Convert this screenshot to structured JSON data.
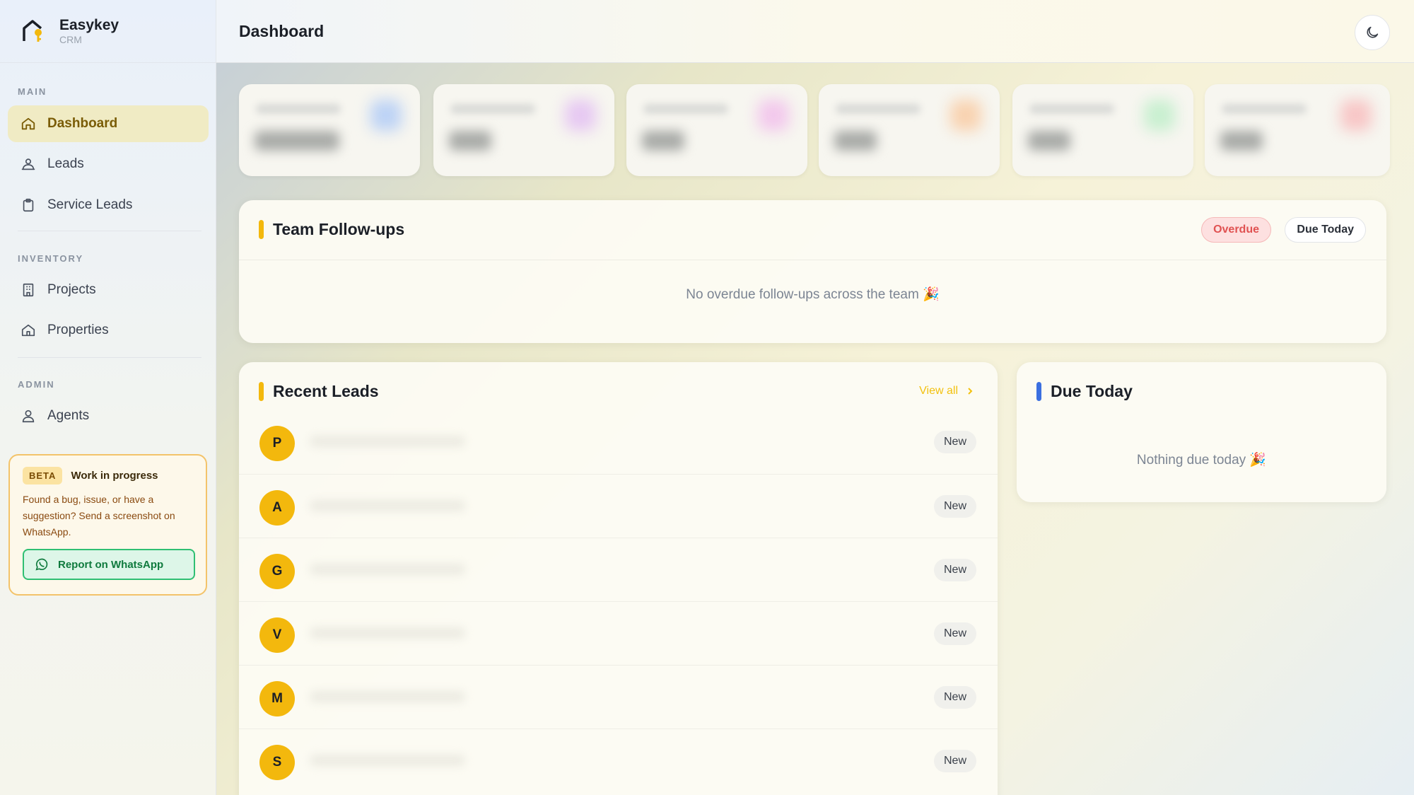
{
  "brand": {
    "name": "Easykey",
    "sub": "CRM"
  },
  "header": {
    "title": "Dashboard",
    "theme_icon": "moon-icon"
  },
  "sidebar": {
    "sections": [
      {
        "title": "MAIN"
      },
      {
        "title": "INVENTORY"
      },
      {
        "title": "ADMIN"
      }
    ],
    "items": [
      {
        "label": "Dashboard",
        "icon": "home-icon",
        "active": true
      },
      {
        "label": "Leads",
        "icon": "users-icon"
      },
      {
        "label": "Service Leads",
        "icon": "clipboard-icon"
      },
      {
        "label": "Projects",
        "icon": "building-icon"
      },
      {
        "label": "Properties",
        "icon": "house-icon"
      },
      {
        "label": "Agents",
        "icon": "user-icon"
      }
    ],
    "beta": {
      "badge": "BETA",
      "title": "Work in progress",
      "text": "Found a bug, issue, or have a suggestion? Send a screenshot on WhatsApp.",
      "button": "Report on WhatsApp"
    }
  },
  "stats": {
    "accent_colors": [
      "#bcd2f5",
      "#e6c8f2",
      "#f2c8ec",
      "#f8d2b0",
      "#c8efd0",
      "#f7c6c6"
    ]
  },
  "followups": {
    "title": "Team Follow-ups",
    "tabs": {
      "overdue": "Overdue",
      "due_today": "Due Today"
    },
    "empty": "No overdue follow-ups across the team 🎉"
  },
  "recent_leads": {
    "title": "Recent Leads",
    "view_all": "View all",
    "rows": [
      {
        "initial": "P",
        "status": "New"
      },
      {
        "initial": "A",
        "status": "New"
      },
      {
        "initial": "G",
        "status": "New"
      },
      {
        "initial": "V",
        "status": "New"
      },
      {
        "initial": "M",
        "status": "New"
      },
      {
        "initial": "S",
        "status": "New"
      }
    ]
  },
  "due_today": {
    "title": "Due Today",
    "empty": "Nothing due today 🎉"
  },
  "colors": {
    "accent": "#f3b80d",
    "due_today_bar": "#3b6fe0",
    "overdue": "#e05252",
    "whatsapp": "#2fbf73"
  }
}
